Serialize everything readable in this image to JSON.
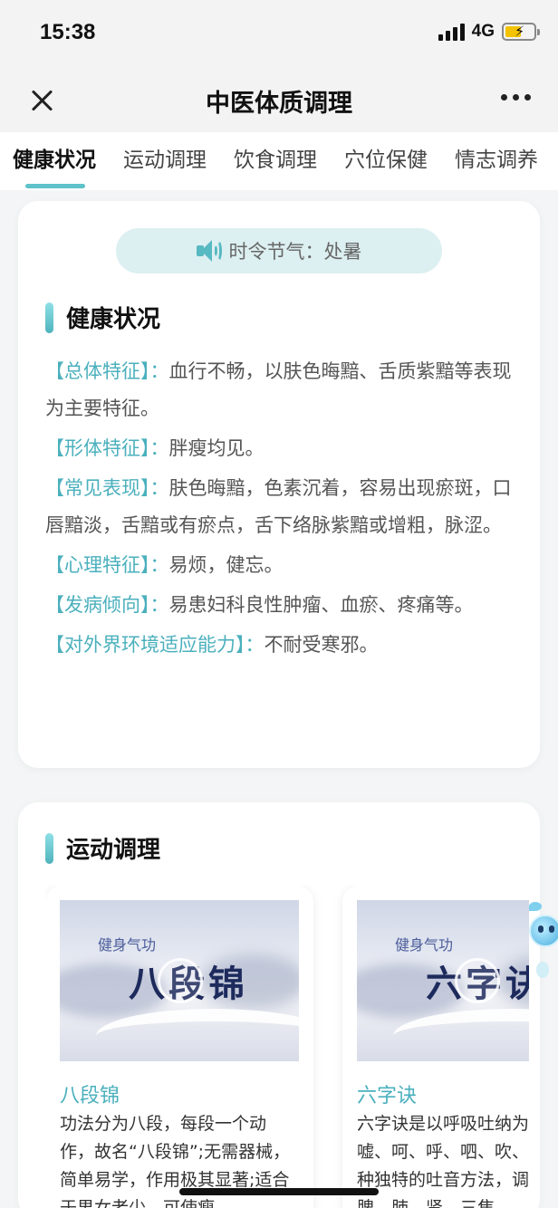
{
  "status_bar": {
    "time": "15:38",
    "network": "4G"
  },
  "nav": {
    "title": "中医体质调理"
  },
  "tabs": [
    {
      "label": "健康状况",
      "active": true
    },
    {
      "label": "运动调理",
      "active": false
    },
    {
      "label": "饮食调理",
      "active": false
    },
    {
      "label": "穴位保健",
      "active": false
    },
    {
      "label": "情志调养",
      "active": false
    }
  ],
  "solar_term": {
    "label": "时令节气：处暑",
    "icon": "speaker-icon"
  },
  "health": {
    "title": "健康状况",
    "items": [
      {
        "label": "【总体特征】：",
        "text": "血行不畅，以肤色晦黯、舌质紫黯等表现为主要特征。"
      },
      {
        "label": "【形体特征】：",
        "text": "胖瘦均见。"
      },
      {
        "label": "【常见表现】：",
        "text": "肤色晦黯，色素沉着，容易出现瘀斑，口唇黯淡，舌黯或有瘀点，舌下络脉紫黯或增粗，脉涩。"
      },
      {
        "label": "【心理特征】：",
        "text": "易烦，健忘。"
      },
      {
        "label": "【发病倾向】：",
        "text": "易患妇科良性肿瘤、血瘀、疼痛等。"
      },
      {
        "label": "【对外界环境适应能力】：",
        "text": "不耐受寒邪。"
      }
    ]
  },
  "exercise": {
    "title": "运动调理",
    "cards": [
      {
        "image_subtitle": "健身气功",
        "image_title": "八段锦",
        "name": "八段锦",
        "desc": "功法分为八段，每段一个动作，故名“八段锦”;无需器械，简单易学，作用极其显著;适合于男女老少，可使瘦"
      },
      {
        "image_subtitle": "健身气功",
        "image_title": "六字诀",
        "name": "六字诀",
        "desc": "六字诀是以呼吸吐纳为主，合嘘、呵、呼、呬、吹、嘻，一种独特的吐音方法，调节心、脾、肺、肾、三焦"
      }
    ]
  },
  "colors": {
    "accent": "#4bb0bd",
    "tab_indicator": "#5ec2c9",
    "solar_bg": "#dceff1"
  }
}
